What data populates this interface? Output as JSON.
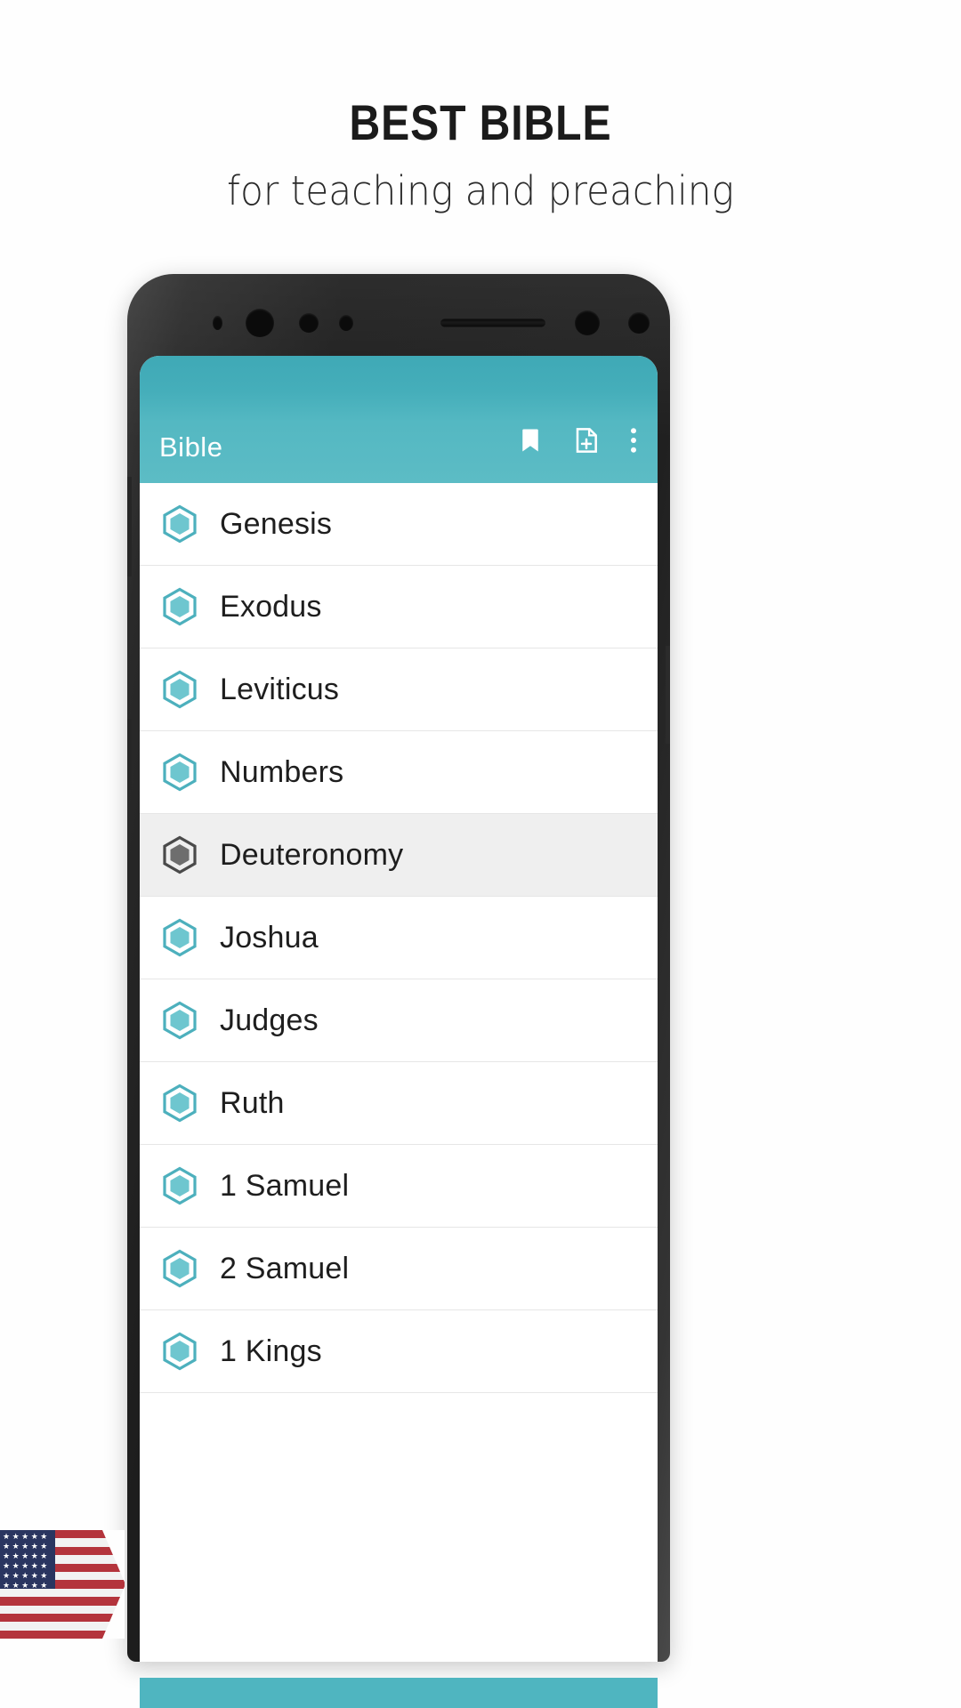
{
  "promo": {
    "title": "BEST BIBLE",
    "subtitle": "for teaching and preaching"
  },
  "app": {
    "appbar": {
      "title": "Bible",
      "background_color": "#4fb2bd",
      "icons": [
        {
          "name": "bookmark-icon",
          "label": "Bookmarks"
        },
        {
          "name": "note-add-icon",
          "label": "Add note"
        },
        {
          "name": "overflow-menu-icon",
          "label": "More options"
        }
      ]
    },
    "book_list": {
      "accent_color": "#4db0bd",
      "selected_index": 4,
      "items": [
        {
          "label": "Genesis",
          "selected": false
        },
        {
          "label": "Exodus",
          "selected": false
        },
        {
          "label": "Leviticus",
          "selected": false
        },
        {
          "label": "Numbers",
          "selected": false
        },
        {
          "label": "Deuteronomy",
          "selected": true
        },
        {
          "label": "Joshua",
          "selected": false
        },
        {
          "label": "Judges",
          "selected": false
        },
        {
          "label": "Ruth",
          "selected": false
        },
        {
          "label": "1 Samuel",
          "selected": false
        },
        {
          "label": "2 Samuel",
          "selected": false
        },
        {
          "label": "1 Kings",
          "selected": false
        }
      ]
    }
  },
  "decor": {
    "flag": {
      "name": "us-flag",
      "stripe_red": "#b4343c",
      "canton_blue": "#2a3560"
    }
  }
}
